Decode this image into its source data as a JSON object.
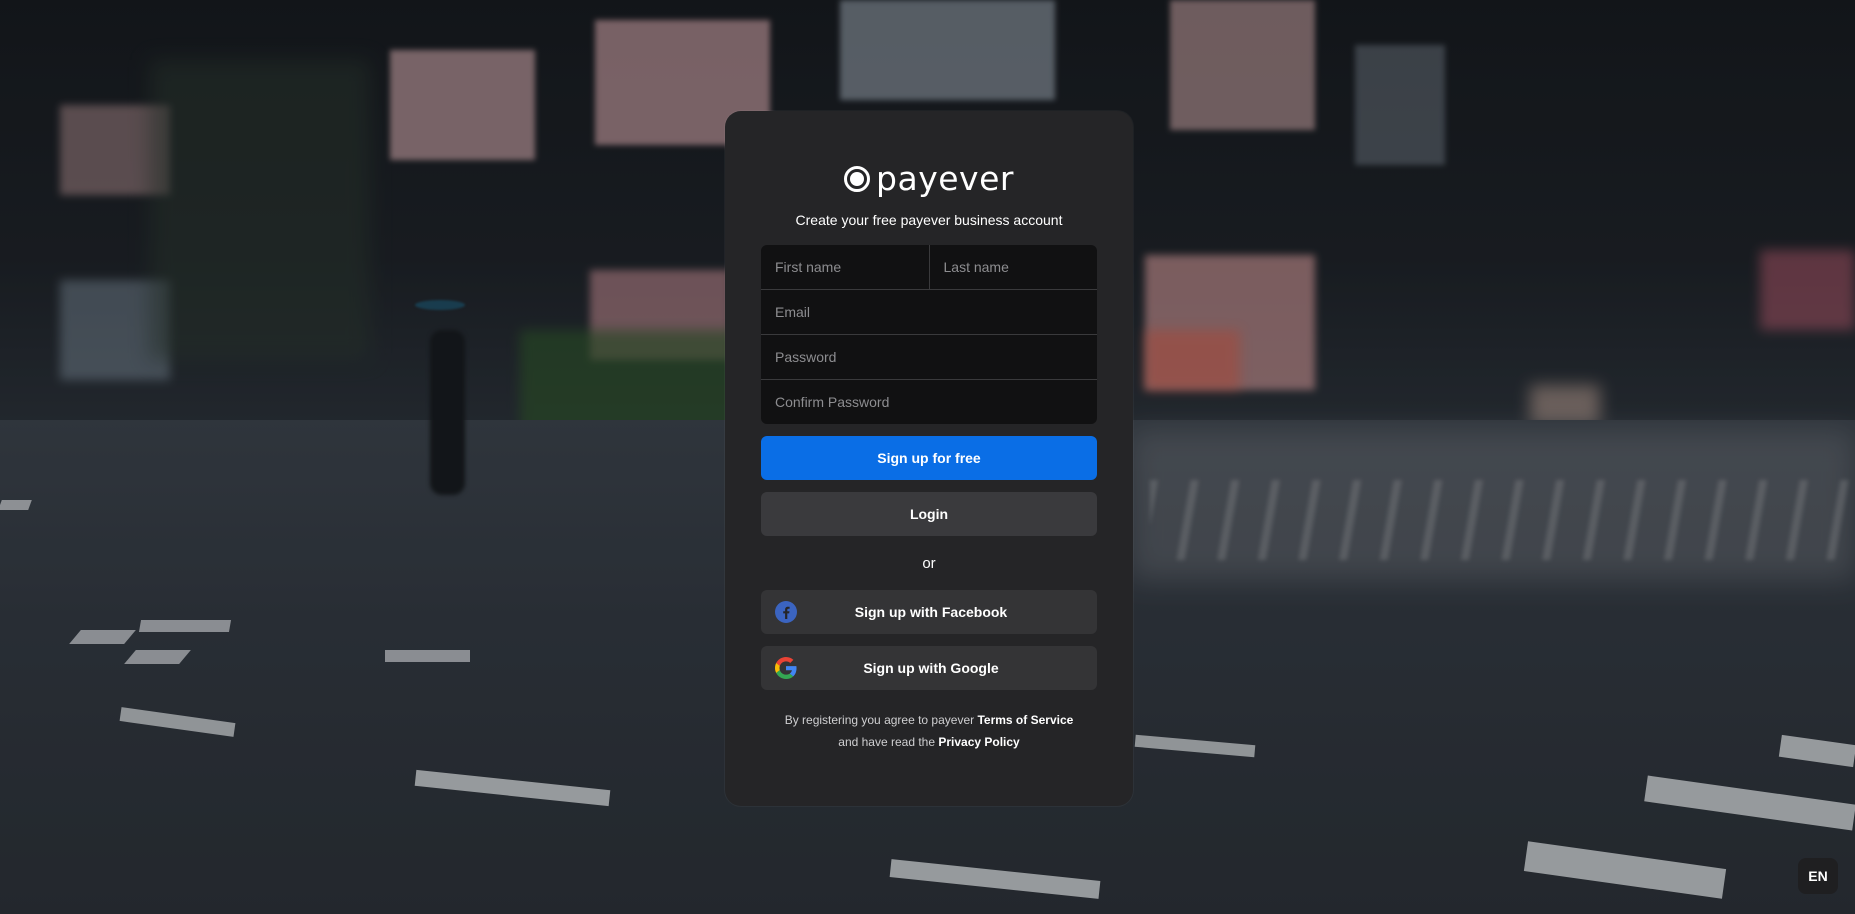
{
  "brand": {
    "name": "payever",
    "logo_icon": "payever-circle-logo",
    "accent_color": "#0a6ee6"
  },
  "signup": {
    "subtitle": "Create your free payever business account",
    "fields": {
      "first_name_placeholder": "First name",
      "last_name_placeholder": "Last name",
      "email_placeholder": "Email",
      "password_placeholder": "Password",
      "confirm_password_placeholder": "Confirm Password"
    },
    "primary_button": "Sign up for free",
    "login_button": "Login",
    "separator": "or",
    "facebook_button": "Sign up with Facebook",
    "google_button": "Sign up with Google",
    "legal": {
      "line1_prefix": "By registering you agree to payever ",
      "terms_link": "Terms of Service",
      "line2_prefix": "and have read the ",
      "privacy_link": "Privacy Policy"
    }
  },
  "language": {
    "current": "EN"
  },
  "icons": {
    "facebook": "facebook-icon",
    "google": "google-icon"
  }
}
